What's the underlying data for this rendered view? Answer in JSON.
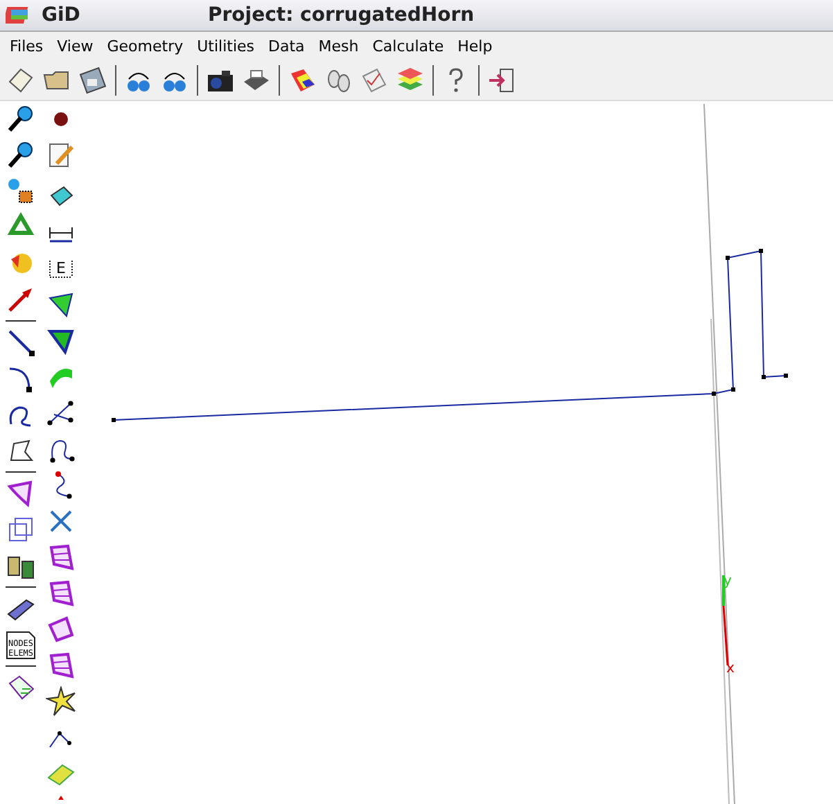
{
  "window": {
    "app": "GiD",
    "title": "Project: corrugatedHorn"
  },
  "menu": [
    "Files",
    "View",
    "Geometry",
    "Utilities",
    "Data",
    "Mesh",
    "Calculate",
    "Help"
  ],
  "side_toolbar": {
    "dimension_letter": "E",
    "table_lines": [
      "NODES",
      "ELEMS"
    ]
  },
  "axes": {
    "y_label": "y",
    "x_label": "x"
  }
}
